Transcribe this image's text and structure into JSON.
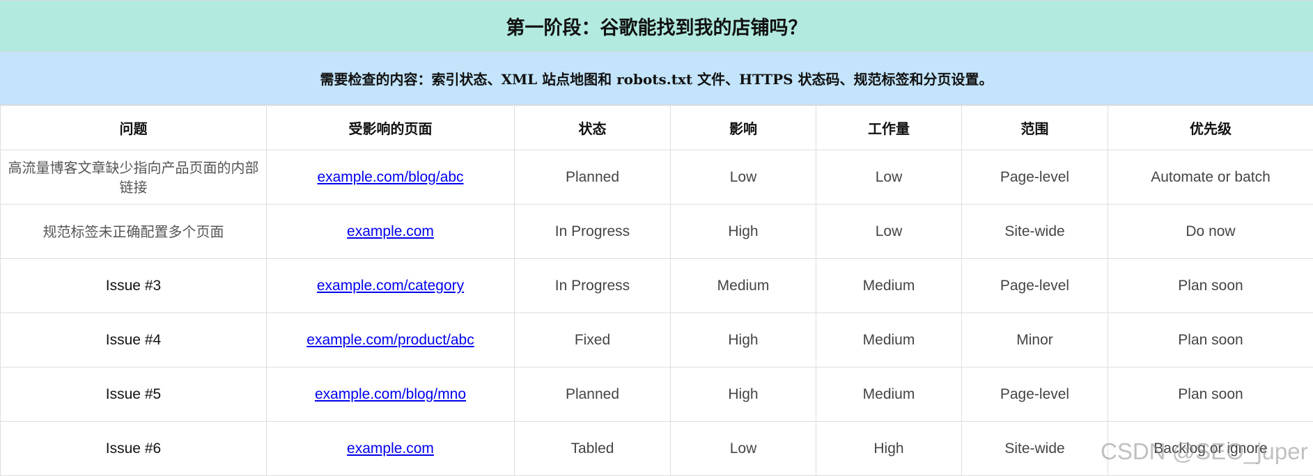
{
  "title": "第一阶段：谷歌能找到我的店铺吗？",
  "subtitle": "需要检查的内容：索引状态、XML 站点地图和 robots.txt 文件、HTTPS 状态码、规范标签和分页设置。",
  "table": {
    "headers": [
      "问题",
      "受影响的页面",
      "状态",
      "影响",
      "工作量",
      "范围",
      "优先级"
    ],
    "rows": [
      {
        "issue": "高流量博客文章缺少指向产品页面的内部链接",
        "page": "example.com/blog/abc",
        "status": "Planned",
        "impact": "Low",
        "effort": "Low",
        "scope": "Page-level",
        "priority": "Automate or batch"
      },
      {
        "issue": "规范标签未正确配置多个页面",
        "page": "example.com",
        "status": "In Progress",
        "impact": "High",
        "effort": "Low",
        "scope": "Site-wide",
        "priority": "Do now"
      },
      {
        "issue": "Issue #3",
        "page": "example.com/category",
        "status": "In Progress",
        "impact": "Medium",
        "effort": "Medium",
        "scope": "Page-level",
        "priority": "Plan soon"
      },
      {
        "issue": "Issue #4",
        "page": "example.com/product/abc",
        "status": "Fixed",
        "impact": "High",
        "effort": "Medium",
        "scope": "Minor",
        "priority": "Plan soon"
      },
      {
        "issue": "Issue #5",
        "page": "example.com/blog/mno",
        "status": "Planned",
        "impact": "High",
        "effort": "Medium",
        "scope": "Page-level",
        "priority": "Plan soon"
      },
      {
        "issue": "Issue #6",
        "page": "example.com",
        "status": "Tabled",
        "impact": "Low",
        "effort": "High",
        "scope": "Site-wide",
        "priority": "Backlog or ignore"
      }
    ]
  },
  "watermark": "CSDN @SEO_juper",
  "colors": {
    "title_bg": "#b2eadf",
    "subtitle_bg": "#c3e4fb",
    "link": "#0000ee",
    "grid": "#dedede"
  }
}
